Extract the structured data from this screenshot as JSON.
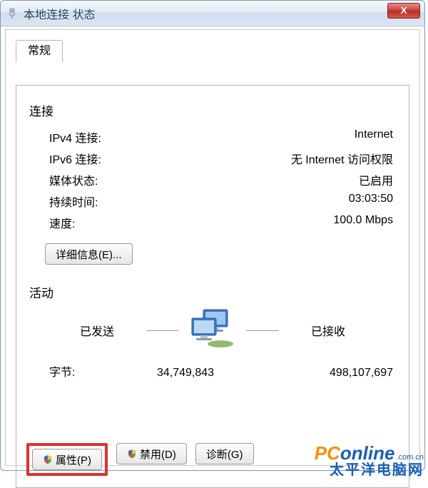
{
  "window": {
    "title": "本地连接 状态",
    "close_glyph": "X"
  },
  "tab": {
    "general": "常规"
  },
  "connection": {
    "section": "连接",
    "ipv4_label": "IPv4 连接:",
    "ipv4_value": "Internet",
    "ipv6_label": "IPv6 连接:",
    "ipv6_value": "无 Internet 访问权限",
    "media_label": "媒体状态:",
    "media_value": "已启用",
    "duration_label": "持续时间:",
    "duration_value": "03:03:50",
    "speed_label": "速度:",
    "speed_value": "100.0 Mbps",
    "details_btn": "详细信息(E)..."
  },
  "activity": {
    "section": "活动",
    "sent_header": "已发送",
    "recv_header": "已接收",
    "bytes_label": "字节:",
    "sent_bytes": "34,749,843",
    "recv_bytes": "498,107,697"
  },
  "buttons": {
    "properties": "属性(P)",
    "disable": "禁用(D)",
    "diagnose": "诊断(G)"
  },
  "watermark": {
    "brand_pc": "PC",
    "brand_rest": "online",
    "brand_suffix": ".com.cn",
    "line2": "太平洋电脑网"
  }
}
